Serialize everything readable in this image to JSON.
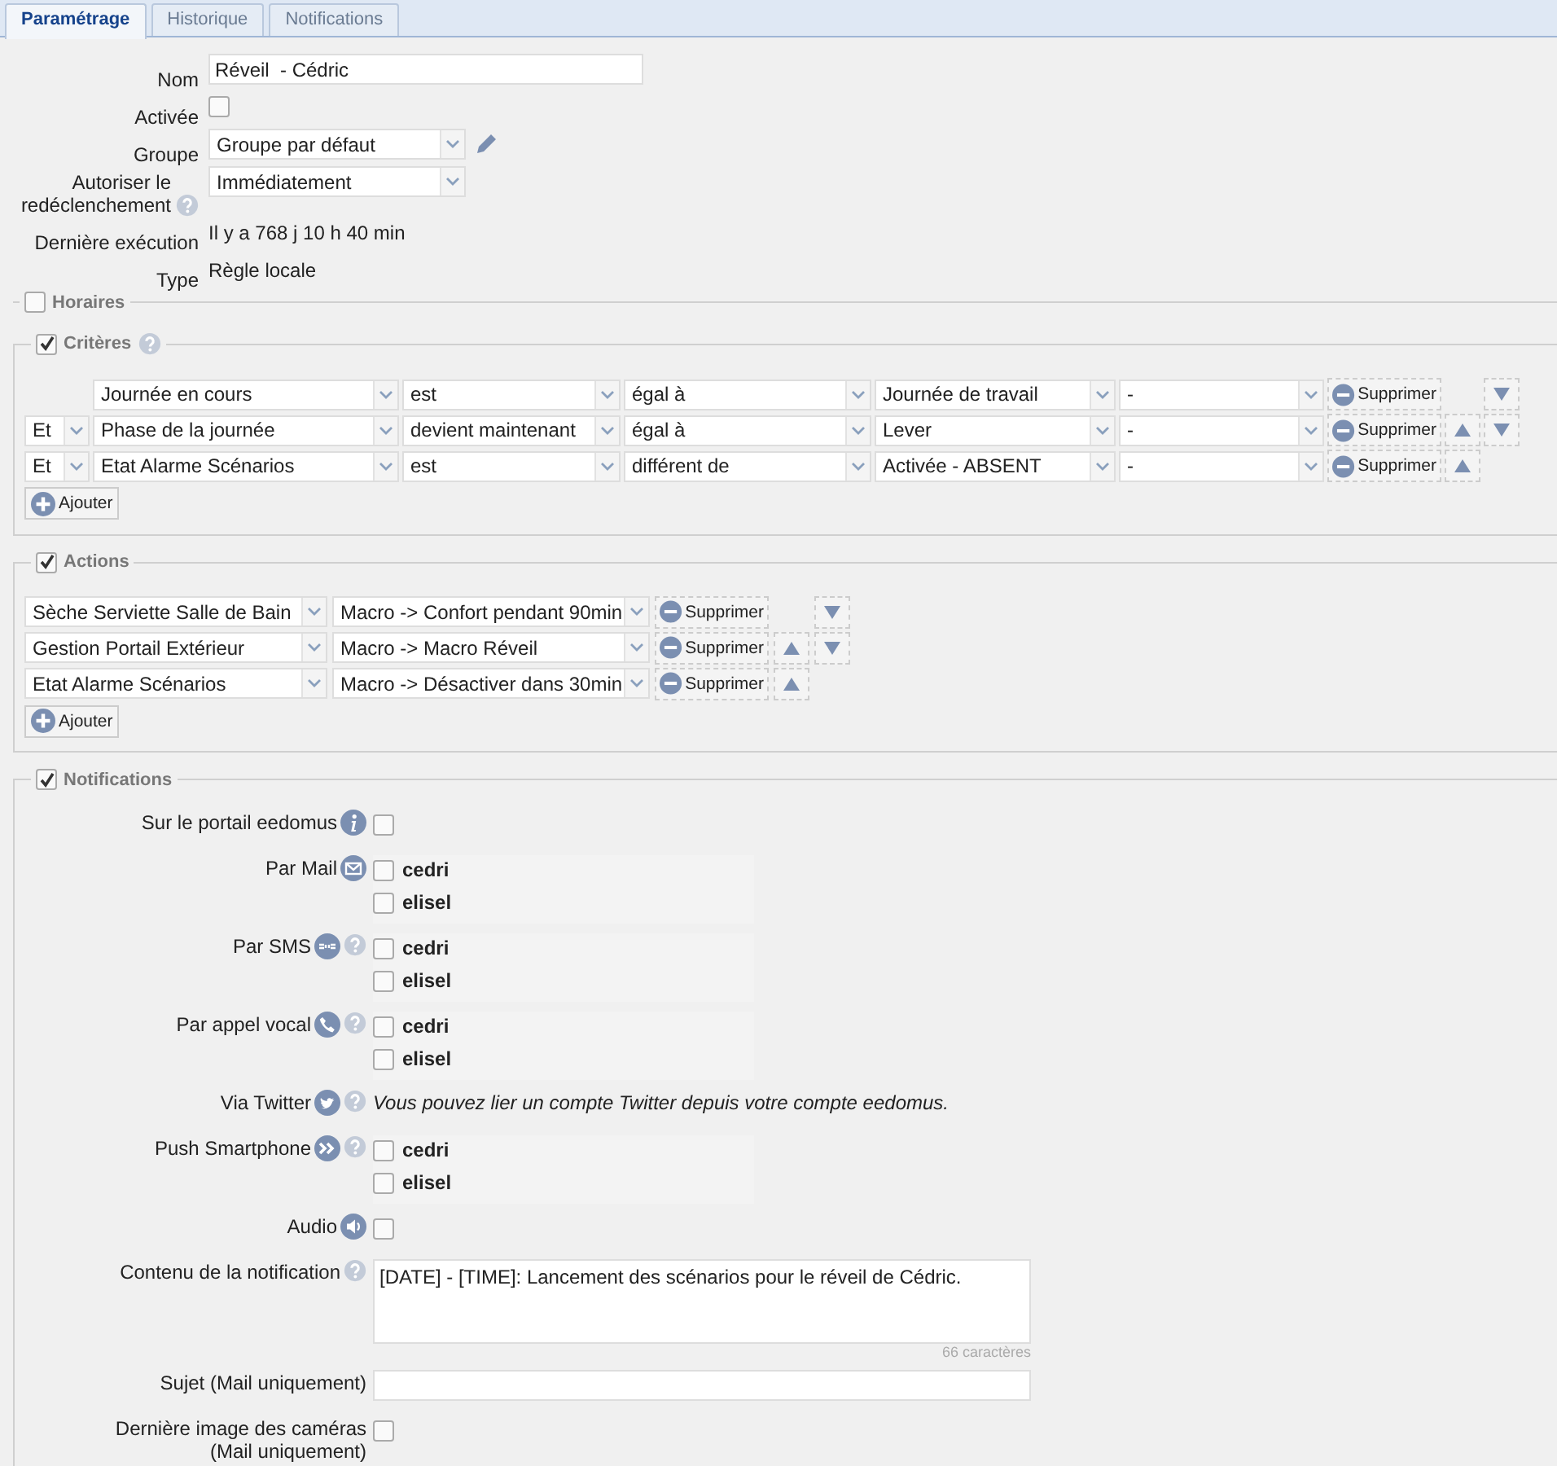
{
  "tabs": [
    {
      "label": "Paramétrage",
      "selected": true
    },
    {
      "label": "Historique",
      "selected": false
    },
    {
      "label": "Notifications",
      "selected": false
    }
  ],
  "general": [
    {
      "kind": "text",
      "label": "Nom",
      "value": "Réveil  - Cédric",
      "help": false
    },
    {
      "kind": "checkbox",
      "label": "Activée",
      "checked": false,
      "help": false
    },
    {
      "kind": "select",
      "label": "Groupe",
      "value": "Groupe par défaut",
      "editable": true,
      "help": false
    },
    {
      "kind": "select",
      "label": "Autoriser le redéclenchement",
      "value": "Immédiatement",
      "editable": false,
      "help": true
    },
    {
      "kind": "static",
      "label": "Dernière exécution",
      "value": "Il y a 768 j 10 h 40 min",
      "help": false
    },
    {
      "kind": "static",
      "label": "Type",
      "value": "Règle locale",
      "help": false
    }
  ],
  "sections": [
    {
      "kind": "schedule",
      "title": "Horaires",
      "checked": false,
      "help": false
    },
    {
      "kind": "criteria",
      "title": "Critères",
      "checked": true,
      "help": true,
      "add": "Ajouter",
      "rows": [
        {
          "fields": [
            "Journée en cours",
            "est",
            "égal à",
            "Journée de travail",
            "-"
          ],
          "remove": "Supprimer",
          "up": false,
          "down": true
        },
        {
          "connector": "Et",
          "fields": [
            "Phase de la journée",
            "devient maintenant",
            "égal à",
            "Lever",
            "-"
          ],
          "remove": "Supprimer",
          "up": true,
          "down": true
        },
        {
          "connector": "Et",
          "fields": [
            "Etat Alarme Scénarios",
            "est",
            "différent de",
            "Activée - ABSENT",
            "-"
          ],
          "remove": "Supprimer",
          "up": true,
          "down": false
        }
      ]
    },
    {
      "kind": "actions",
      "title": "Actions",
      "checked": true,
      "help": false,
      "add": "Ajouter",
      "rows": [
        {
          "fields": [
            "Sèche Serviette Salle de Bain",
            "Macro -> Confort pendant 90min"
          ],
          "remove": "Supprimer",
          "up": false,
          "down": true
        },
        {
          "fields": [
            "Gestion Portail Extérieur",
            "Macro -> Macro Réveil"
          ],
          "remove": "Supprimer",
          "up": true,
          "down": true
        },
        {
          "fields": [
            "Etat Alarme Scénarios",
            "Macro -> Désactiver dans 30min"
          ],
          "remove": "Supprimer",
          "up": true,
          "down": false
        }
      ]
    },
    {
      "kind": "notifications",
      "title": "Notifications",
      "checked": true,
      "help": false,
      "items": [
        {
          "kind": "checkbox",
          "label": "Sur le portail eedomus",
          "help": false,
          "checked": false
        },
        {
          "kind": "recipients",
          "label": "Par Mail",
          "help": false,
          "recipients": [
            {
              "name": "cedri",
              "checked": false
            },
            {
              "name": "elisel",
              "checked": false
            }
          ]
        },
        {
          "kind": "recipients",
          "label": "Par SMS",
          "help": true,
          "recipients": [
            {
              "name": "cedri",
              "checked": false
            },
            {
              "name": "elisel",
              "checked": false
            }
          ]
        },
        {
          "kind": "recipients",
          "label": "Par appel vocal",
          "help": true,
          "recipients": [
            {
              "name": "cedri",
              "checked": false
            },
            {
              "name": "elisel",
              "checked": false
            }
          ]
        },
        {
          "kind": "note",
          "label": "Via Twitter",
          "help": true,
          "text": "Vous pouvez lier un compte Twitter depuis votre compte eedomus."
        },
        {
          "kind": "recipients",
          "label": "Push Smartphone",
          "help": true,
          "recipients": [
            {
              "name": "cedri",
              "checked": false
            },
            {
              "name": "elisel",
              "checked": false
            }
          ]
        },
        {
          "kind": "checkbox",
          "label": "Audio",
          "help": false,
          "checked": false
        },
        {
          "kind": "textarea",
          "label": "Contenu de la notification",
          "help": true,
          "value": "[DATE] - [TIME]: Lancement des scénarios pour le réveil de Cédric.",
          "counter": "66 caractères"
        },
        {
          "kind": "text",
          "label": "Sujet (Mail uniquement)",
          "help": false
        },
        {
          "kind": "checkbox",
          "label": "Dernière image des caméras\n(Mail uniquement)",
          "help": false,
          "checked": false
        }
      ]
    }
  ]
}
